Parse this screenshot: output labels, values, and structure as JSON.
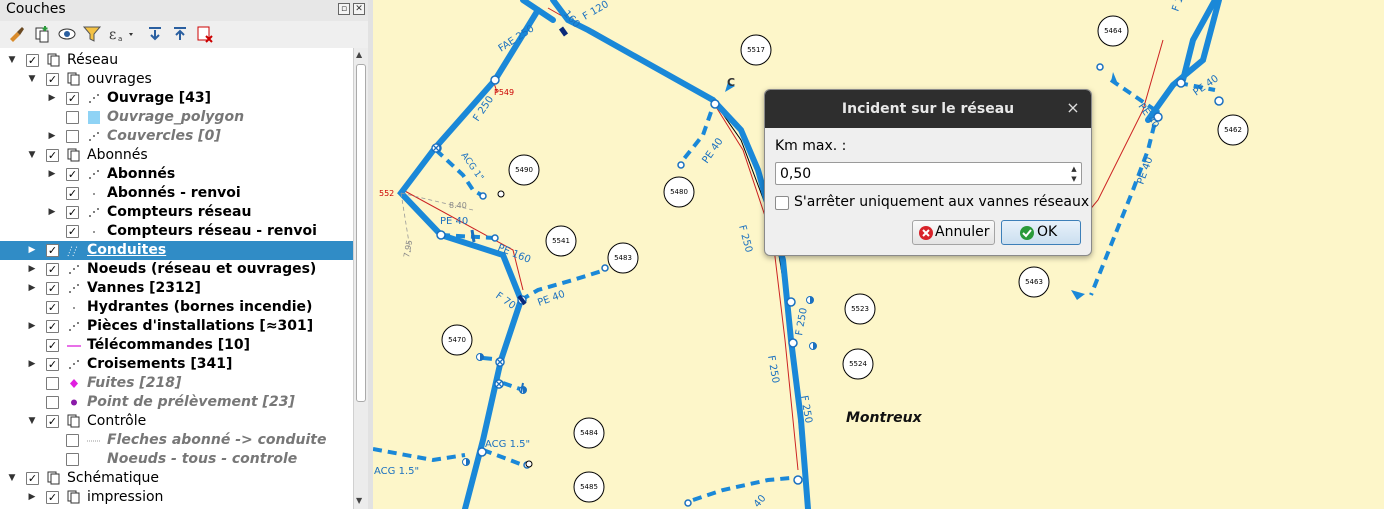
{
  "panel": {
    "title": "Couches",
    "restore_icon": "restore-icon",
    "close_icon": "close-icon",
    "toolbar": [
      "style-brush-icon",
      "add-group-icon",
      "visibility-eye-icon",
      "filter-icon",
      "expression-filter-icon",
      "expand-all-icon",
      "collapse-all-icon",
      "remove-layer-icon"
    ]
  },
  "layers": [
    {
      "label": "Réseau",
      "level": 0,
      "expanded": true,
      "checked": true,
      "kind": "group",
      "style": "normal"
    },
    {
      "label": "ouvrages",
      "level": 1,
      "expanded": true,
      "checked": true,
      "kind": "group",
      "style": "normal"
    },
    {
      "label": "Ouvrage [43]",
      "level": 2,
      "expanded": false,
      "checked": true,
      "kind": "points",
      "style": "bold"
    },
    {
      "label": "Ouvrage_polygon",
      "level": 2,
      "expanded": null,
      "checked": false,
      "kind": "polygon",
      "style": "grey"
    },
    {
      "label": "Couvercles [0]",
      "level": 2,
      "expanded": false,
      "checked": false,
      "kind": "points",
      "style": "grey"
    },
    {
      "label": "Abonnés",
      "level": 1,
      "expanded": true,
      "checked": true,
      "kind": "group",
      "style": "normal"
    },
    {
      "label": "Abonnés",
      "level": 2,
      "expanded": false,
      "checked": true,
      "kind": "points",
      "style": "bold"
    },
    {
      "label": "Abonnés - renvoi",
      "level": 2,
      "expanded": null,
      "checked": true,
      "kind": "dot",
      "style": "bold"
    },
    {
      "label": "Compteurs réseau",
      "level": 2,
      "expanded": false,
      "checked": true,
      "kind": "points",
      "style": "bold"
    },
    {
      "label": "Compteurs réseau - renvoi",
      "level": 2,
      "expanded": null,
      "checked": true,
      "kind": "dot",
      "style": "bold"
    },
    {
      "label": "Conduites",
      "level": 1,
      "expanded": false,
      "checked": true,
      "kind": "lines",
      "style": "bold",
      "selected": true
    },
    {
      "label": "Noeuds (réseau et ouvrages)",
      "level": 1,
      "expanded": false,
      "checked": true,
      "kind": "points",
      "style": "bold"
    },
    {
      "label": "Vannes [2312]",
      "level": 1,
      "expanded": false,
      "checked": true,
      "kind": "points",
      "style": "bold"
    },
    {
      "label": "Hydrantes (bornes incendie)",
      "level": 1,
      "expanded": null,
      "checked": true,
      "kind": "dot",
      "style": "bold"
    },
    {
      "label": "Pièces d'installations [≈301]",
      "level": 1,
      "expanded": false,
      "checked": true,
      "kind": "points",
      "style": "bold"
    },
    {
      "label": "Télécommandes [10]",
      "level": 1,
      "expanded": null,
      "checked": true,
      "kind": "pinkline",
      "style": "bold"
    },
    {
      "label": "Croisements [341]",
      "level": 1,
      "expanded": false,
      "checked": true,
      "kind": "points",
      "style": "bold"
    },
    {
      "label": "Fuites [218]",
      "level": 1,
      "expanded": null,
      "checked": false,
      "kind": "diamond",
      "style": "grey"
    },
    {
      "label": "Point de prélèvement [23]",
      "level": 1,
      "expanded": null,
      "checked": false,
      "kind": "purpledot",
      "style": "grey"
    },
    {
      "label": "Contrôle",
      "level": 1,
      "expanded": true,
      "checked": true,
      "kind": "group",
      "style": "normal"
    },
    {
      "label": "Fleches abonné -> conduite",
      "level": 2,
      "expanded": null,
      "checked": false,
      "kind": "dotted",
      "style": "grey"
    },
    {
      "label": "Noeuds - tous - controle",
      "level": 2,
      "expanded": null,
      "checked": false,
      "kind": "none",
      "style": "grey"
    },
    {
      "label": "Schématique",
      "level": 0,
      "expanded": true,
      "checked": true,
      "kind": "group",
      "style": "normal"
    },
    {
      "label": "impression",
      "level": 1,
      "expanded": false,
      "checked": true,
      "kind": "group",
      "style": "normal"
    }
  ],
  "map": {
    "place_name": "Montreux",
    "pipe_labels": [
      "F 120",
      "160",
      "FAE 250",
      "F 250",
      "P549",
      "ACG 1\"",
      "552",
      "8.40",
      "7.95",
      "PE 40",
      "PE 160",
      "F 70",
      "PE 40",
      "PE 40",
      "F 250",
      "F 250",
      "F 250",
      "F 250",
      "ACG 1.5\"",
      "ACG 1.5\"",
      "40",
      "PE 40",
      "PE 40",
      "F 1",
      "C"
    ],
    "node_numbers": [
      "5517",
      "5490",
      "5480",
      "5541",
      "5483",
      "5470",
      "5484",
      "5485",
      "5523",
      "5524",
      "5464",
      "5462",
      "5463"
    ]
  },
  "dialog": {
    "title": "Incident sur le réseau",
    "km_label": "Km max. :",
    "km_value": "0,50",
    "stop_label": "S'arrêter uniquement aux vannes réseaux",
    "stop_checked": false,
    "cancel_label": "Annuler",
    "ok_label": "OK",
    "accent": "#3d7fb8"
  },
  "colors": {
    "map_bg": "#fdf6c9",
    "pipe": "#1a88d8",
    "selection": "#308cc6"
  }
}
